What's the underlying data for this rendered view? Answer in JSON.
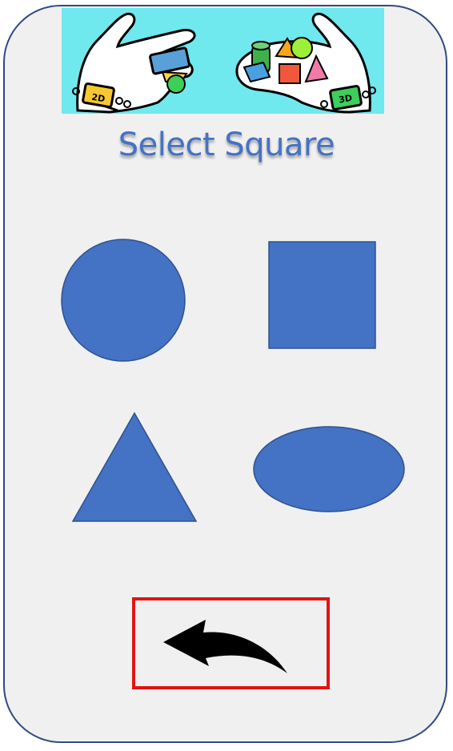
{
  "header": {
    "banner_icon": "2d-3d-shapes-hands-banner",
    "badge_2d": "2D",
    "badge_3d": "3D"
  },
  "title": "Select Square",
  "shapes": [
    {
      "name": "circle",
      "icon": "circle-icon"
    },
    {
      "name": "square",
      "icon": "square-icon"
    },
    {
      "name": "triangle",
      "icon": "triangle-icon"
    },
    {
      "name": "oval",
      "icon": "oval-icon"
    }
  ],
  "back": {
    "icon": "back-arrow-icon"
  },
  "colors": {
    "shape_fill": "#4472c4",
    "shape_stroke": "#2f528f",
    "title_color": "#4472c4",
    "card_bg": "#f0f0f0",
    "card_border": "#2f4a80",
    "banner_bg": "#6fe8ee",
    "back_border": "#e01414"
  }
}
